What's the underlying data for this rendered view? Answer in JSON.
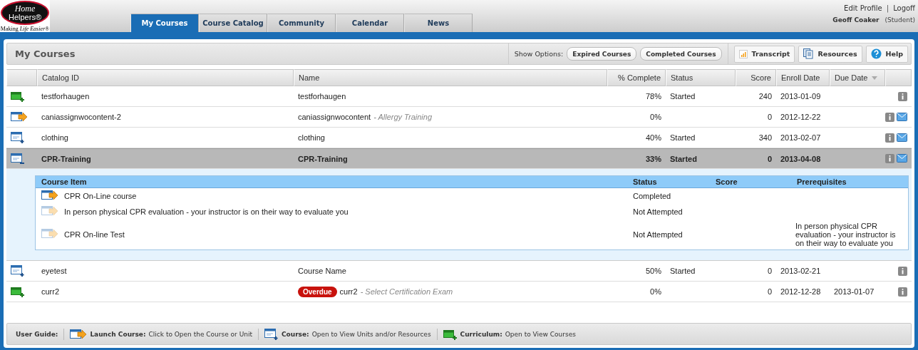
{
  "logo": {
    "line1": "Home",
    "line2": "Helpers®",
    "tagline": "Making *Life Easier*®"
  },
  "tabs": [
    {
      "label": "My Courses",
      "selected": true
    },
    {
      "label": "Course Catalog",
      "selected": false
    },
    {
      "label": "Community",
      "selected": false
    },
    {
      "label": "Calendar",
      "selected": false
    },
    {
      "label": "News",
      "selected": false
    }
  ],
  "user_menu": {
    "links": [
      "Edit Profile",
      "Logoff"
    ],
    "separator": "|",
    "user_name": "Geoff Coaker",
    "role": "(Student)"
  },
  "page_title": "My Courses",
  "toolbar": {
    "show_options_label": "Show Options:",
    "option_buttons": [
      "Expired Courses",
      "Completed Courses"
    ],
    "tool_buttons": [
      {
        "kind": "transcript",
        "label": "Transcript"
      },
      {
        "kind": "resources",
        "label": "Resources"
      },
      {
        "kind": "help",
        "label": "Help"
      }
    ]
  },
  "table": {
    "columns": [
      {},
      {
        "label": "Catalog ID"
      },
      {
        "label": "Name"
      },
      {
        "label": "% Complete"
      },
      {
        "label": "Status"
      },
      {
        "label": "Score"
      },
      {
        "label": "Enroll Date"
      },
      {
        "label": "Due Date",
        "sorted": true
      },
      {}
    ],
    "rows": [
      {
        "kind": "curriculum",
        "selected": false,
        "catalog_id": "testforhaugen",
        "name": "testforhaugen",
        "complete": "78%",
        "status": "Started",
        "score": "240",
        "enroll_date": "2013-01-09",
        "mail": false
      },
      {
        "kind": "launch",
        "selected": false,
        "catalog_id": "caniassignwocontent-2",
        "name": "caniassignwocontent",
        "subtitle": "- Allergy Training",
        "complete": "0%",
        "score": "0",
        "enroll_date": "2012-12-22",
        "mail": true
      },
      {
        "kind": "course",
        "expanded": false,
        "selected": false,
        "catalog_id": "clothing",
        "name": "clothing",
        "complete": "40%",
        "status": "Started",
        "score": "340",
        "enroll_date": "2013-02-07",
        "mail": true
      },
      {
        "kind": "course",
        "expanded": true,
        "selected": true,
        "catalog_id": "CPR-Training",
        "name": "CPR-Training",
        "complete": "33%",
        "status": "Started",
        "score": "0",
        "enroll_date": "2013-04-08",
        "mail": true,
        "items": {
          "columns": [
            "Course Item",
            "Status",
            "Score",
            "Prerequisites"
          ],
          "rows": [
            {
              "name": "CPR On-Line course",
              "disabled": false,
              "status": "Completed"
            },
            {
              "name": "In person physical CPR evaluation - your instructor is on their way to evaluate you",
              "disabled": true,
              "status": "Not Attempted"
            },
            {
              "name": "CPR On-line Test",
              "disabled": true,
              "status": "Not Attempted",
              "prerequisites": "In person physical CPR evaluation - your instructor is on their way to evaluate you"
            }
          ]
        }
      },
      {
        "kind": "course",
        "expanded": false,
        "selected": false,
        "catalog_id": "eyetest",
        "name": "Course Name",
        "complete": "50%",
        "status": "Started",
        "score": "0",
        "enroll_date": "2013-02-21",
        "mail": false
      },
      {
        "kind": "curriculum",
        "selected": false,
        "catalog_id": "curr2",
        "badge": "Overdue",
        "name": "curr2",
        "subtitle": "- Select Certification Exam",
        "complete": "0%",
        "score": "0",
        "enroll_date": "2012-12-28",
        "due_date": "2013-01-07",
        "mail": false
      }
    ]
  },
  "user_guide": {
    "label": "User Guide:",
    "items": [
      {
        "kind": "launch",
        "label": "Launch Course:",
        "text": "Click to Open the Course or Unit"
      },
      {
        "kind": "course",
        "label": "Course:",
        "text": "Open to View Units and/or Resources"
      },
      {
        "kind": "curriculum",
        "label": "Curriculum:",
        "text": "Open to View Courses"
      }
    ]
  }
}
